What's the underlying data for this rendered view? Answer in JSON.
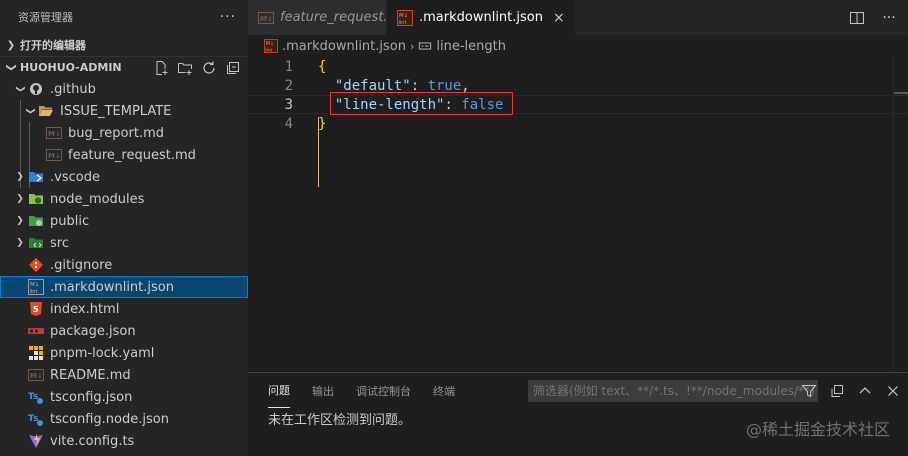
{
  "explorer": {
    "title": "资源管理器",
    "more": "···",
    "open_editors": "打开的编辑器",
    "project": "HUOHUO-ADMIN",
    "items": [
      {
        "label": ".github"
      },
      {
        "label": "ISSUE_TEMPLATE"
      },
      {
        "label": "bug_report.md"
      },
      {
        "label": "feature_request.md"
      },
      {
        "label": ".vscode"
      },
      {
        "label": "node_modules"
      },
      {
        "label": "public"
      },
      {
        "label": "src"
      },
      {
        "label": ".gitignore"
      },
      {
        "label": ".markdownlint.json"
      },
      {
        "label": "index.html"
      },
      {
        "label": "package.json"
      },
      {
        "label": "pnpm-lock.yaml"
      },
      {
        "label": "README.md"
      },
      {
        "label": "tsconfig.json"
      },
      {
        "label": "tsconfig.node.json"
      },
      {
        "label": "vite.config.ts"
      }
    ]
  },
  "tabs": [
    {
      "label": "feature_request.md",
      "icon": "markdown-icon"
    },
    {
      "label": ".markdownlint.json",
      "icon": "markdownlint-icon",
      "close": "×"
    }
  ],
  "breadcrumb": {
    "file": ".markdownlint.json",
    "sep": "›",
    "symbol": "line-length"
  },
  "code": {
    "lines": [
      {
        "num": "1",
        "brace": "{"
      },
      {
        "num": "2",
        "key": "\"default\"",
        "colon": ": ",
        "value": "true",
        "comma": ","
      },
      {
        "num": "3",
        "key": "\"line-length\"",
        "colon": ": ",
        "value": "false"
      },
      {
        "num": "4",
        "brace": "}"
      }
    ]
  },
  "panel": {
    "tabs": [
      "问题",
      "输出",
      "调试控制台",
      "终端"
    ],
    "filter_placeholder": "筛选器(例如 text、**/*.ts、!**/node_modules/**)",
    "message": "未在工作区检测到问题。"
  },
  "watermark": "@稀土掘金技术社区",
  "colors": {
    "accent": "#007fd4",
    "selection": "#094771",
    "highlight_box": "#e8363a"
  }
}
